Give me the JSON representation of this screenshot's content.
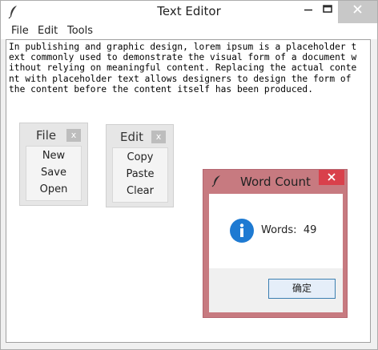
{
  "window": {
    "title": "Text Editor",
    "icon": "feather-icon",
    "controls": [
      "minimize-icon",
      "maximize-icon",
      "close-icon"
    ]
  },
  "menubar": {
    "items": [
      {
        "label": "File"
      },
      {
        "label": "Edit"
      },
      {
        "label": "Tools"
      }
    ]
  },
  "editor": {
    "lines": [
      "In publishing and graphic design, lorem ipsum is a placeholder t",
      "ext commonly used to demonstrate the visual form of a document w",
      "ithout relying on meaningful content. Replacing the actual conte",
      "nt with placeholder text allows designers to design the form of",
      "the content before the content itself has been produced."
    ]
  },
  "file_panel": {
    "title": "File",
    "close_label": "x",
    "buttons": [
      {
        "label": "New"
      },
      {
        "label": "Save"
      },
      {
        "label": "Open"
      }
    ]
  },
  "edit_panel": {
    "title": "Edit",
    "close_label": "x",
    "buttons": [
      {
        "label": "Copy"
      },
      {
        "label": "Paste"
      },
      {
        "label": "Clear"
      }
    ]
  },
  "dialog": {
    "title": "Word Count",
    "icon": "info-icon",
    "words_label": "Words:",
    "words_value": "49",
    "ok_label": "确定"
  },
  "colors": {
    "dialog_frame": "#c77a80",
    "dialog_close": "#d9404b",
    "info_blue": "#1e7ad2",
    "ok_border": "#3c7fb1"
  }
}
